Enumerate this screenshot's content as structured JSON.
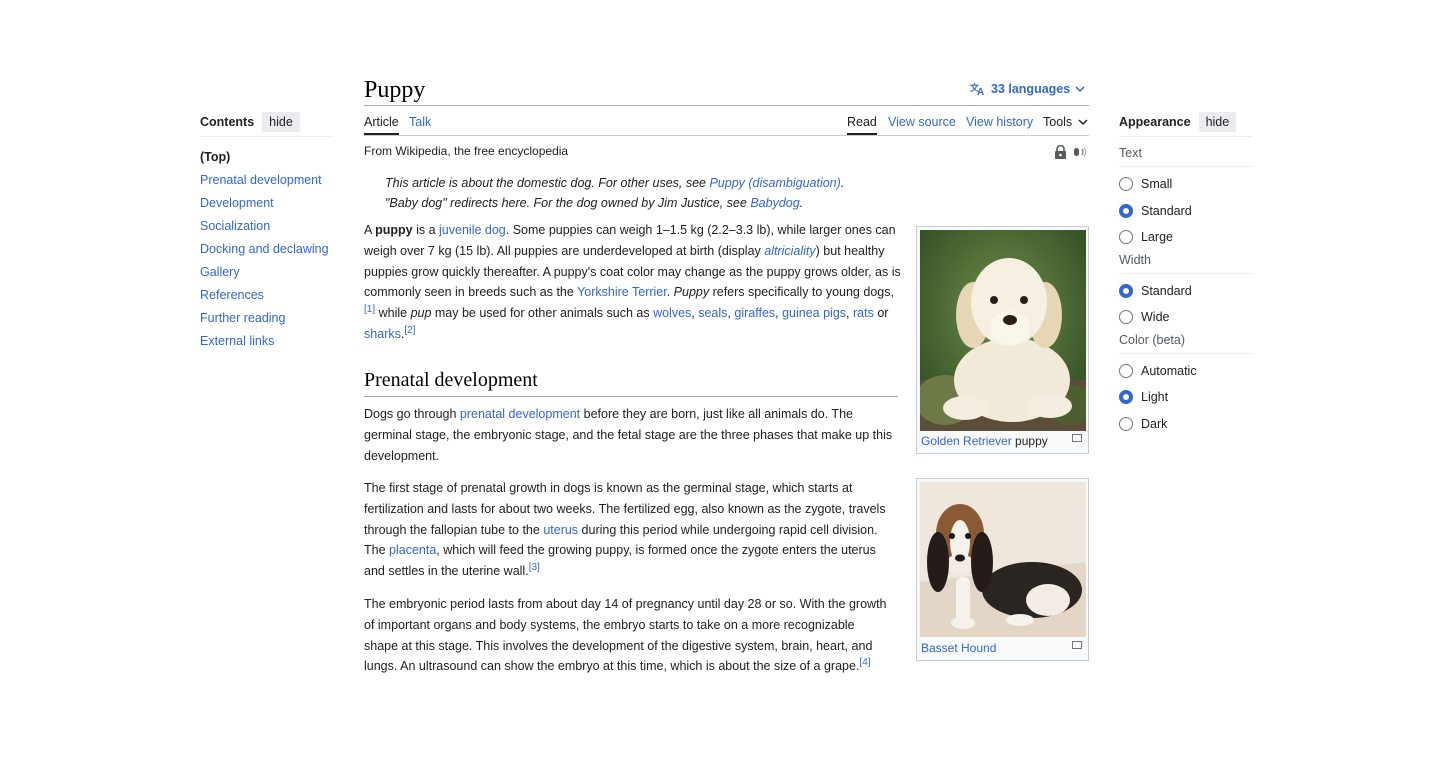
{
  "toc": {
    "heading": "Contents",
    "hide_label": "hide",
    "items": [
      "(Top)",
      "Prenatal development",
      "Development",
      "Socialization",
      "Docking and declawing",
      "Gallery",
      "References",
      "Further reading",
      "External links"
    ]
  },
  "header": {
    "title": "Puppy",
    "languages": "33 languages",
    "tabs_left": [
      "Article",
      "Talk"
    ],
    "tabs_right": [
      "Read",
      "View source",
      "View history",
      "Tools"
    ],
    "from": "From Wikipedia, the free encyclopedia"
  },
  "hatnotes": {
    "line1_text": "This article is about the domestic dog. For other uses, see ",
    "line1_link": "Puppy (disambiguation)",
    "line1_end": ".",
    "line2_text": "\"Baby dog\" redirects here. For the dog owned by Jim Justice, see ",
    "line2_link": "Babydog",
    "line2_end": "."
  },
  "intro": {
    "t1": "A ",
    "b1": "puppy",
    "t2": " is a ",
    "l1": "juvenile dog",
    "t3": ". Some puppies can weigh 1–1.5 kg (2.2–3.3 lb), while larger ones can weigh over 7 kg (15 lb). All puppies are underdeveloped at birth (display ",
    "l2": "altriciality",
    "t4": ") but healthy puppies grow quickly thereafter. A puppy's coat color may change as the puppy grows older, as is commonly seen in breeds such as the ",
    "l3": "Yorkshire Terrier",
    "t5": ". ",
    "i1": "Puppy",
    "t6": " refers specifically to young dogs,",
    "ref1": "[1]",
    "t7": " while ",
    "i2": "pup",
    "t8": " may be used for other animals such as ",
    "l4": "wolves",
    "t9": ", ",
    "l5": "seals",
    "t10": ", ",
    "l6": "giraffes",
    "t11": ", ",
    "l7": "guinea pigs",
    "t12": ", ",
    "l8": "rats",
    "t13": " or ",
    "l9": "sharks",
    "t14": ".",
    "ref2": "[2]"
  },
  "section": {
    "heading": "Prenatal development",
    "p1_a": "Dogs go through ",
    "p1_link": "prenatal development",
    "p1_b": " before they are born, just like all animals do. The germinal stage, the embryonic stage, and the fetal stage are the three phases that make up this development.",
    "p2_a": "The first stage of prenatal growth in dogs is known as the germinal stage, which starts at fertilization and lasts for about two weeks. The fertilized egg, also known as the zygote, travels through the fallopian tube to the ",
    "p2_link1": "uterus",
    "p2_b": " during this period while undergoing rapid cell division. The ",
    "p2_link2": "placenta",
    "p2_c": ", which will feed the growing puppy, is formed once the zygote enters the uterus and settles in the uterine wall.",
    "p2_ref": "[3]",
    "p3_a": "The embryonic period lasts from about day 14 of pregnancy until day 28 or so. With the growth of important organs and body systems, the embryo starts to take on a more recognizable shape at this stage. This involves the development of the digestive system, brain, heart, and lungs. An ultrasound can show the embryo at this time, which is about the size of a grape.",
    "p3_ref": "[4]"
  },
  "figures": {
    "fig1_link": "Golden Retriever",
    "fig1_text": " puppy",
    "fig2_link": "Basset Hound"
  },
  "appearance": {
    "heading": "Appearance",
    "hide_label": "hide",
    "text_label": "Text",
    "text_options": [
      "Small",
      "Standard",
      "Large"
    ],
    "text_selected": "Standard",
    "width_label": "Width",
    "width_options": [
      "Standard",
      "Wide"
    ],
    "width_selected": "Standard",
    "color_label": "Color (beta)",
    "color_options": [
      "Automatic",
      "Light",
      "Dark"
    ],
    "color_selected": "Light"
  },
  "colors": {
    "link": "#3366cc",
    "text": "#202122",
    "border": "#a2a9b1"
  },
  "icons": [
    "translate-icon",
    "chevron-down-icon",
    "lock-icon",
    "audio-icon",
    "magnify-icon"
  ]
}
